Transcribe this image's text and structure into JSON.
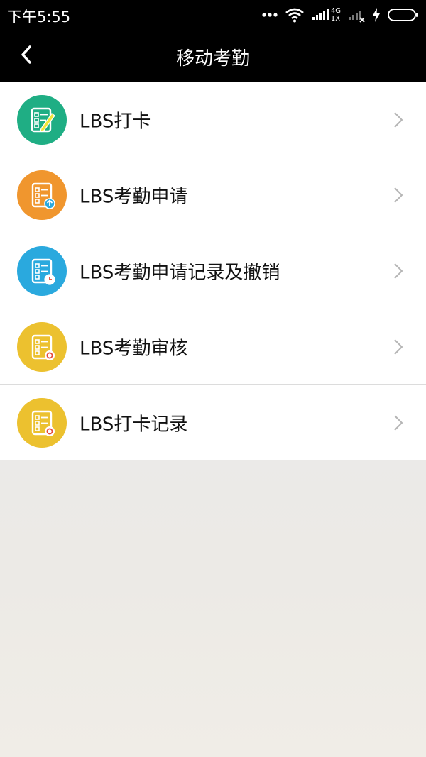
{
  "status_bar": {
    "time": "下午5:55",
    "network_1": "4G",
    "network_2": "1X",
    "icons": [
      "more-dots-icon",
      "wifi-icon",
      "signal-4g-icon",
      "signal-no-service-icon",
      "charging-icon",
      "battery-icon"
    ]
  },
  "header": {
    "title": "移动考勤",
    "back_icon": "back-chevron-icon"
  },
  "menu": {
    "items": [
      {
        "label": "LBS打卡",
        "icon": "checklist-pencil-icon",
        "color": "#1fae84"
      },
      {
        "label": "LBS考勤申请",
        "icon": "checklist-upload-icon",
        "color": "#f0962e"
      },
      {
        "label": "LBS考勤申请记录及撤销",
        "icon": "checklist-clock-icon",
        "color": "#2aa9de"
      },
      {
        "label": "LBS考勤审核",
        "icon": "checklist-review-icon",
        "color": "#ecc12f"
      },
      {
        "label": "LBS打卡记录",
        "icon": "checklist-record-icon",
        "color": "#ecc12f"
      }
    ]
  },
  "colors": {
    "header_bg": "#000000",
    "list_bg": "#ffffff",
    "chevron": "#b5b5b5"
  }
}
